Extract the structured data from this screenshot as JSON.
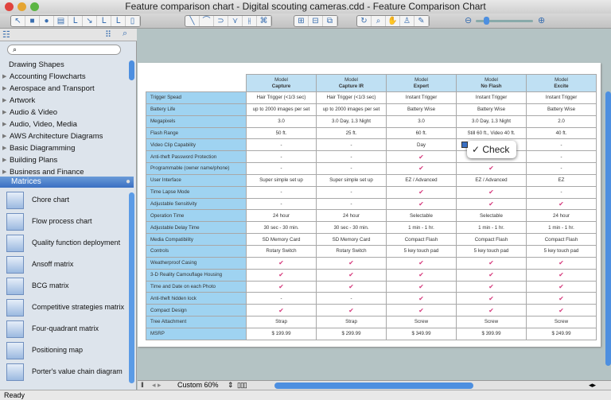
{
  "window": {
    "title": "Feature comparison chart - Digital scouting cameras.cdd - Feature Comparison Chart"
  },
  "sidebar": {
    "search_placeholder": "",
    "categories": [
      "Drawing Shapes",
      "Accounting Flowcharts",
      "Aerospace and Transport",
      "Artwork",
      "Audio & Video",
      "Audio, Video, Media",
      "AWS Architecture Diagrams",
      "Basic Diagramming",
      "Building Plans",
      "Business and Finance"
    ],
    "open_library": "Matrices",
    "shapes": [
      "Chore chart",
      "Flow process chart",
      "Quality function deployment",
      "Ansoff matrix",
      "BCG matrix",
      "Competitive strategies matrix",
      "Four-quadrant matrix",
      "Positioning map",
      "Porter's value chain diagram"
    ]
  },
  "table": {
    "model_label": "Model",
    "models": [
      "Capture",
      "Capture IR",
      "Expert",
      "No Flash",
      "Excite"
    ],
    "rows": [
      {
        "feature": "Trigger Spead",
        "values": [
          "Hair Trigger (<1/3 sec)",
          "Hair Trigger (<1/3 sec)",
          "Instant Trigger",
          "Instant Trigger",
          "Instant Trigger"
        ]
      },
      {
        "feature": "Battery Life",
        "values": [
          "up to 2000 images per set",
          "up to 2000 images per set",
          "Battery Wise",
          "Battery Wise",
          "Battery Wise"
        ]
      },
      {
        "feature": "Megapixels",
        "values": [
          "3.0",
          "3.0 Day, 1.3 Night",
          "3.0",
          "3.0 Day, 1.3 Night",
          "2.0"
        ]
      },
      {
        "feature": "Flash Range",
        "values": [
          "50 ft.",
          "25 ft.",
          "60 ft.",
          "Still 60 ft., Video 40 ft.",
          "40 ft."
        ]
      },
      {
        "feature": "Video Clip Capability",
        "values": [
          "-",
          "-",
          "Day",
          "",
          "-"
        ]
      },
      {
        "feature": "Anti-theft Password Protection",
        "values": [
          "-",
          "-",
          "check",
          "",
          "-"
        ]
      },
      {
        "feature": "Programmable (owner name/phone)",
        "values": [
          "-",
          "-",
          "check",
          "check",
          "-"
        ]
      },
      {
        "feature": "User Interface",
        "values": [
          "Super simple set up",
          "Super simple set up",
          "EZ / Advanced",
          "EZ / Advanced",
          "EZ"
        ]
      },
      {
        "feature": "Time Lapse Mode",
        "values": [
          "-",
          "-",
          "check",
          "check",
          "-"
        ]
      },
      {
        "feature": "Adjustable Sensitivity",
        "values": [
          "-",
          "-",
          "check",
          "check",
          "check"
        ]
      },
      {
        "feature": "Operation Time",
        "values": [
          "24 hour",
          "24 hour",
          "Selectable",
          "Selectable",
          "24 hour"
        ]
      },
      {
        "feature": "Adjustable Delay Time",
        "values": [
          "30 sec - 30 min.",
          "30 sec - 30 min.",
          "1 min - 1 hr.",
          "1 min - 1 hr.",
          "1 min - 1 hr."
        ]
      },
      {
        "feature": "Media Compatibility",
        "values": [
          "SD Memory Card",
          "SD Memory Card",
          "Compact Flash",
          "Compact Flash",
          "Compact Flash"
        ]
      },
      {
        "feature": "Controls",
        "values": [
          "Rotary Switch",
          "Rotary Switch",
          "5 key touch pad",
          "5 key touch pad",
          "5 key touch pad"
        ]
      },
      {
        "feature": "Weatherproof Casing",
        "values": [
          "check",
          "check",
          "check",
          "check",
          "check"
        ]
      },
      {
        "feature": "3-D Reality Camouflage Housing",
        "values": [
          "check",
          "check",
          "check",
          "check",
          "check"
        ]
      },
      {
        "feature": "Time and Date on each Photo",
        "values": [
          "check",
          "check",
          "check",
          "check",
          "check"
        ]
      },
      {
        "feature": "Anti-theft hidden lock",
        "values": [
          "-",
          "-",
          "check",
          "check",
          "check"
        ]
      },
      {
        "feature": "Compact Design",
        "values": [
          "check",
          "check",
          "check",
          "check",
          "check"
        ]
      },
      {
        "feature": "Tree Attachment",
        "values": [
          "Strap",
          "Strap",
          "Screw",
          "Screw",
          "Screw"
        ]
      },
      {
        "feature": "MSRP",
        "values": [
          "$ 199.99",
          "$ 299.99",
          "$ 349.99",
          "$ 399.99",
          "$ 249.99"
        ]
      }
    ]
  },
  "popup": {
    "label": "✓ Check"
  },
  "bottombar": {
    "zoom": "Custom 60%"
  },
  "status": {
    "text": "Ready"
  },
  "colors": {
    "check": "#d63a7d",
    "header": "#bfe0f3",
    "label_col": "#9fd3f1"
  }
}
